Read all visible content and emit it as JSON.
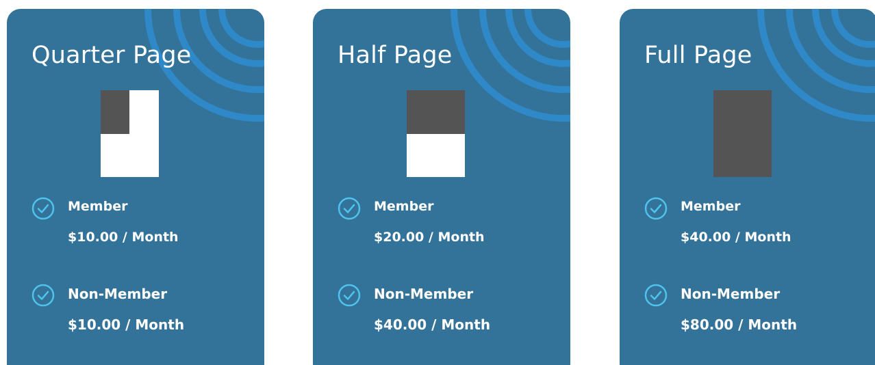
{
  "colors": {
    "card_bg": "#337399",
    "arc": "#2f88c8",
    "page_white": "#ffffff",
    "page_fill": "#545454",
    "check": "#4fc3ec"
  },
  "icons": {
    "check": "check-circle-icon",
    "page": "page-size-icon",
    "decoration": "concentric-arcs-icon"
  },
  "cards": [
    {
      "title": "Quarter Page",
      "page_fill_fraction": "quarter",
      "member": {
        "label": "Member",
        "price": "$10.00 / Month"
      },
      "nonmember": {
        "label": "Non-Member",
        "price": "$10.00 / Month"
      }
    },
    {
      "title": "Half Page",
      "page_fill_fraction": "half",
      "member": {
        "label": "Member",
        "price": "$20.00 / Month"
      },
      "nonmember": {
        "label": "Non-Member",
        "price": "$40.00 / Month"
      }
    },
    {
      "title": "Full Page",
      "page_fill_fraction": "full",
      "member": {
        "label": "Member",
        "price": "$40.00 / Month"
      },
      "nonmember": {
        "label": "Non-Member",
        "price": "$80.00 / Month"
      }
    }
  ]
}
